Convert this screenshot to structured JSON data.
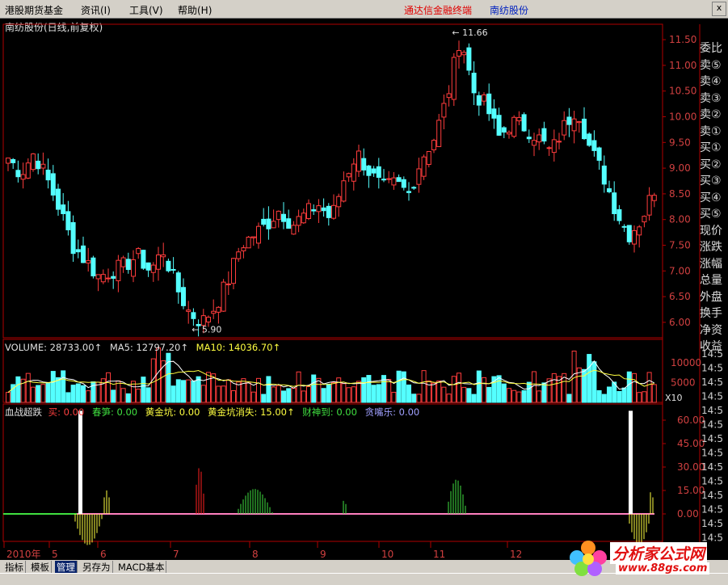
{
  "menu": {
    "items": [
      "港股期货基金",
      "资讯(I)",
      "工具(V)",
      "帮助(H)"
    ],
    "brand": "通达信金融终端",
    "stock_name": "南纺股份",
    "close": "x"
  },
  "main_title": "南纺股份(日线,前复权)",
  "price_axis": [
    "11.50",
    "11.00",
    "10.50",
    "10.00",
    "9.50",
    "9.00",
    "8.50",
    "8.00",
    "7.50",
    "7.00",
    "6.50",
    "6.00"
  ],
  "price_high_label": "11.66",
  "price_low_label": "5.90",
  "right_panel": [
    "委比",
    "卖⑤",
    "卖④",
    "卖③",
    "卖②",
    "卖①",
    "买①",
    "买②",
    "买③",
    "买④",
    "买⑤",
    "现价",
    "涨跌",
    "涨幅",
    "总量",
    "外盘",
    "换手",
    "净资",
    "收益"
  ],
  "volume": {
    "label": "VOLUME: 28733.00↑",
    "ma5": "MA5: 12797.20↑",
    "ma10": "MA10: 14036.70↑",
    "axis": [
      "10000",
      "5000"
    ],
    "unit": "X10"
  },
  "indicator": {
    "name": "血战超跌",
    "buy": "买: 0.00",
    "chunsun": "春笋: 0.00",
    "huangjinkeng": "黄金坑: 0.00",
    "huangjinkeng_xiaoshi": "黄金坑消失: 15.00↑",
    "caishen": "财神到: 0.00",
    "tanzui": "贪嘴乐: 0.00",
    "axis": [
      "60.00",
      "45.00",
      "30.00",
      "15.00",
      "0.00"
    ]
  },
  "time_axis": [
    "2010年",
    "5",
    "6",
    "7",
    "8",
    "9",
    "10",
    "11",
    "12"
  ],
  "right_time_labels": [
    "14:5",
    "14:5",
    "14:5",
    "14:5",
    "14:5",
    "14:5",
    "14:5",
    "14:5",
    "14:5",
    "14:5",
    "14:5",
    "14:5",
    "14:5",
    "14:5"
  ],
  "bottom_tabs": [
    "指标",
    "模板",
    "管理",
    "另存为",
    "MACD基本"
  ],
  "watermark": {
    "line1": "分析家公式网",
    "line2": "www.88gs.com"
  },
  "colors": {
    "up": "#ff3c3c",
    "down": "#54ffff",
    "axis": "#b00000",
    "white": "#ffffff",
    "yellow": "#ffff40",
    "green": "#40e040",
    "pink": "#ff80c0"
  },
  "chart_data": {
    "type": "candlestick",
    "title": "南纺股份(日线,前复权)",
    "ylim": [
      5.7,
      11.8
    ],
    "high": 11.66,
    "low": 5.9,
    "closes_approx": [
      9.2,
      8.9,
      9.3,
      8.8,
      8.2,
      7.5,
      7.2,
      6.9,
      7.0,
      7.1,
      7.3,
      7.0,
      7.4,
      6.7,
      6.2,
      6.0,
      6.3,
      6.8,
      7.5,
      7.7,
      7.9,
      8.2,
      7.9,
      8.1,
      8.3,
      8.0,
      8.8,
      9.3,
      8.9,
      8.6,
      8.7,
      8.5,
      9.2,
      9.6,
      10.4,
      11.6,
      10.5,
      10.2,
      9.6,
      9.9,
      9.8,
      9.6,
      9.3,
      9.8,
      10.2,
      9.4,
      8.9,
      8.2,
      7.7,
      8.0,
      8.6
    ]
  }
}
